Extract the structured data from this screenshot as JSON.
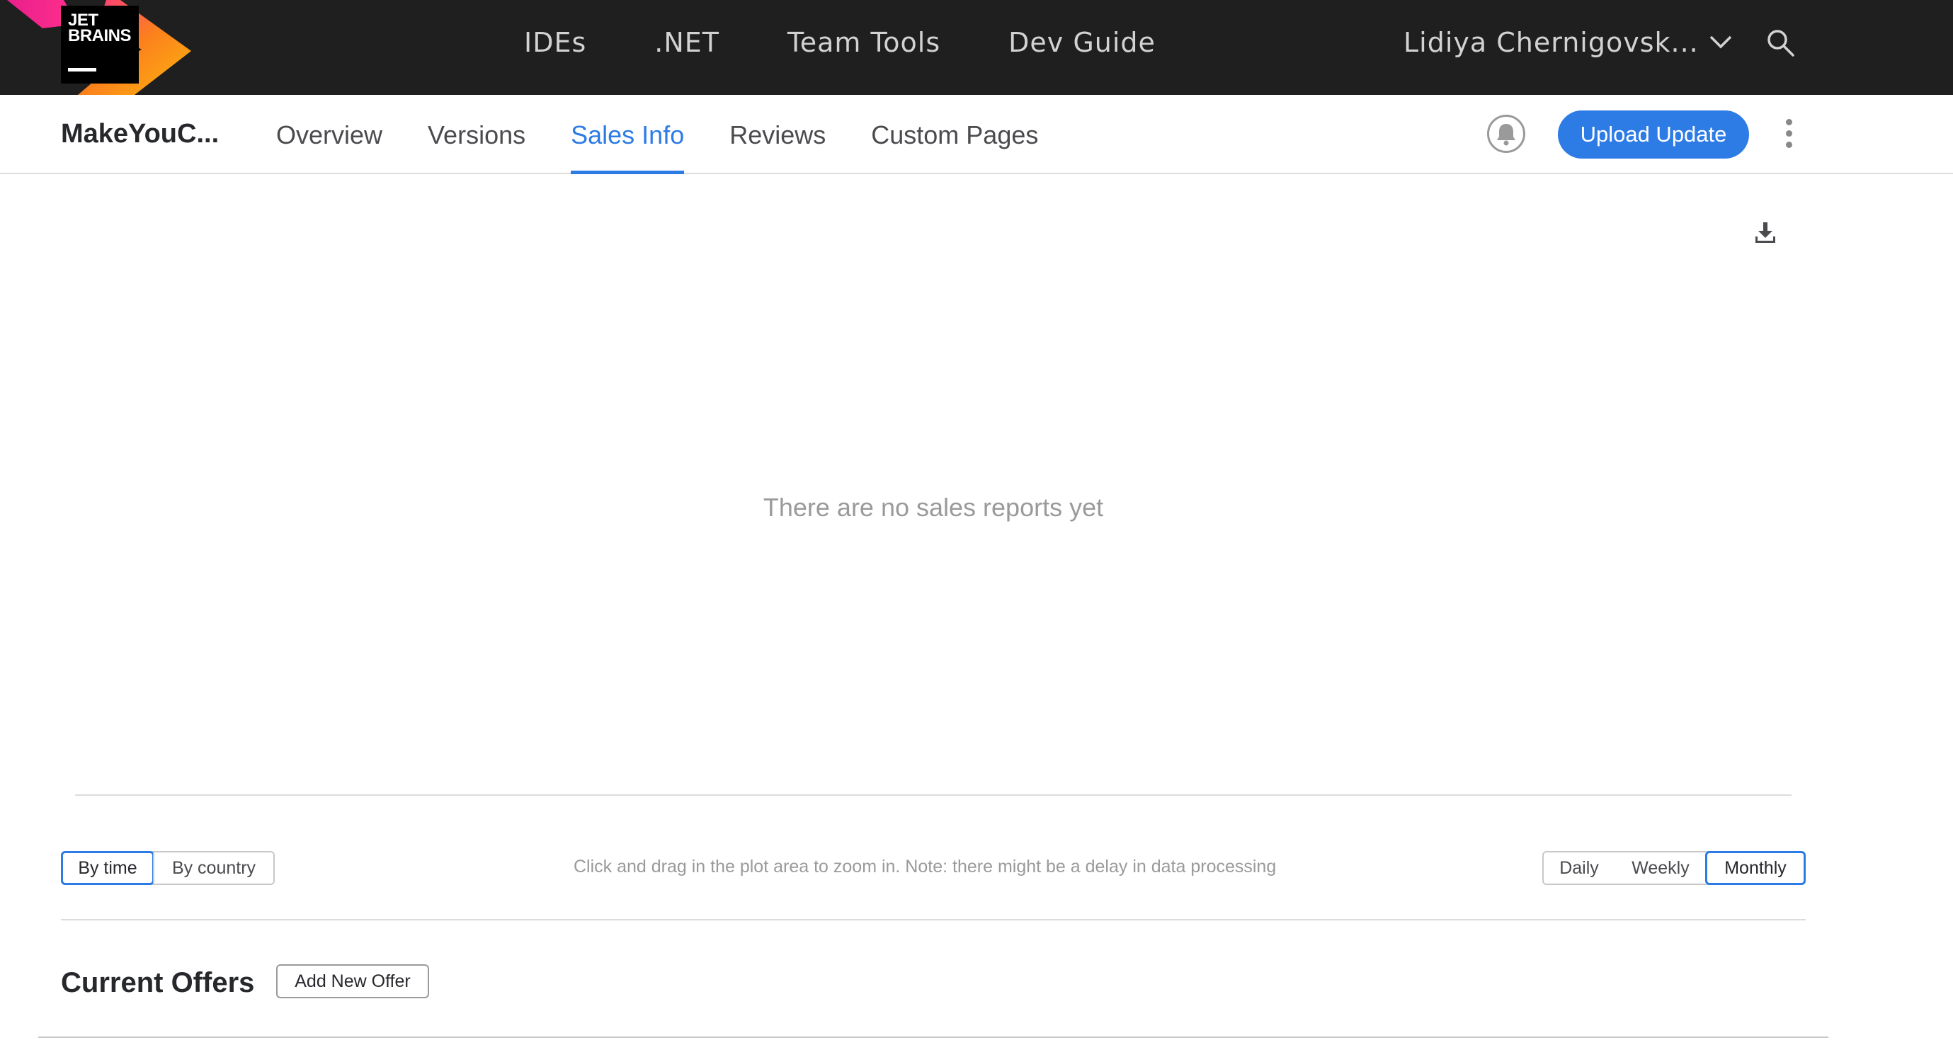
{
  "brand": {
    "logo_text_line1": "JET",
    "logo_text_line2": "BRAINS"
  },
  "topnav": {
    "items": [
      {
        "label": "IDEs"
      },
      {
        "label": ".NET"
      },
      {
        "label": "Team Tools"
      },
      {
        "label": "Dev Guide"
      }
    ]
  },
  "user": {
    "name": "Lidiya Chernigovsk..."
  },
  "plugin": {
    "name": "MakeYouC..."
  },
  "tabs": [
    {
      "label": "Overview",
      "active": false
    },
    {
      "label": "Versions",
      "active": false
    },
    {
      "label": "Sales Info",
      "active": true
    },
    {
      "label": "Reviews",
      "active": false
    },
    {
      "label": "Custom Pages",
      "active": false
    }
  ],
  "actions": {
    "upload_label": "Upload Update"
  },
  "chart": {
    "empty_message": "There are no sales reports yet"
  },
  "view_toggle": {
    "options": [
      {
        "label": "By time",
        "selected": true
      },
      {
        "label": "By country",
        "selected": false
      }
    ]
  },
  "hint_text": "Click and drag in the plot area to zoom in. Note: there might be a delay in data processing",
  "period_toggle": {
    "options": [
      {
        "label": "Daily",
        "selected": false
      },
      {
        "label": "Weekly",
        "selected": false
      },
      {
        "label": "Monthly",
        "selected": true
      }
    ]
  },
  "offers": {
    "title": "Current Offers",
    "add_label": "Add New Offer"
  },
  "colors": {
    "accent": "#2d7be5",
    "topbar": "#1f1f1f",
    "muted_text": "#9a9a9a"
  },
  "icons": [
    "jetbrains-logo",
    "chevron-down-icon",
    "search-icon",
    "bell-icon",
    "more-vertical-icon",
    "download-icon"
  ]
}
